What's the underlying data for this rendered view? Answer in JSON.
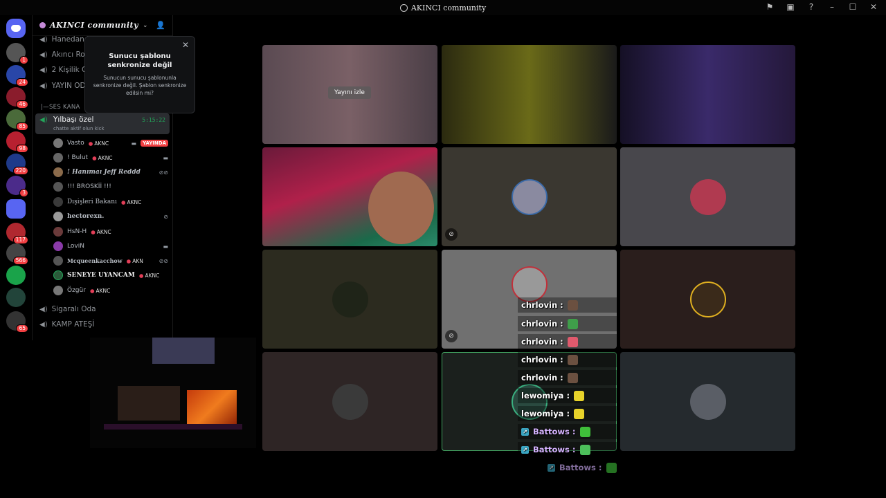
{
  "window": {
    "title": "AKINCI community"
  },
  "titlebar_icons": [
    "flag-icon",
    "screen-icon",
    "help-icon",
    "minimize-icon",
    "maximize-icon",
    "close-icon"
  ],
  "guild_badges": [
    "1",
    "24",
    "46",
    "85",
    "98",
    "220",
    "3",
    "117",
    "566",
    "65"
  ],
  "server": {
    "name": "AKINCI community"
  },
  "channels": {
    "top": [
      "Hanedan M",
      "Akıncı Ro",
      "2 Kişilik O",
      "YAYIN OD"
    ],
    "category": "|—SES KANA",
    "active": {
      "name": "Yılbaşı özel",
      "status": "chatte aktif olun kick",
      "timer": "5:15:22"
    },
    "bottom": [
      "Sigaralı Oda",
      "KAMP ATEŞİ"
    ]
  },
  "voice_users": [
    {
      "name": "Vasto",
      "tag": "AKNC",
      "live": "YAYINDA"
    },
    {
      "name": "! Bulut",
      "tag": "AKNC"
    },
    {
      "name": "! Hanımaı Jeff Reddd"
    },
    {
      "name": "!!! BROSKİİ !!!"
    },
    {
      "name": "Dışişleri Bakanı",
      "tag": "AKNC"
    },
    {
      "name": "hectorexn."
    },
    {
      "name": "HsN-H",
      "tag": "AKNC"
    },
    {
      "name": "LoviN"
    },
    {
      "name": "Mcqueenkacchow",
      "tag": "AKN"
    },
    {
      "name": "SENEYE UYANCAM",
      "tag": "AKNC"
    },
    {
      "name": "Özgür",
      "tag": "AKNC"
    }
  ],
  "popup": {
    "title": "Sunucu şablonu senkronize değil",
    "body": "Sunucun sunucu şablonunla senkronize değil. Şablon senkronize edilsin mi?"
  },
  "stream_tile": {
    "watch_label": "Yayını izle"
  },
  "chat_overlay": [
    {
      "user": "chrlovin :",
      "emote": "#6b5040"
    },
    {
      "user": "chrlovin :",
      "emote": "#3f9e4a"
    },
    {
      "user": "chrlovin :",
      "emote": "#e05a6d"
    },
    {
      "user": "chrlovin :",
      "emote": "#6b5040"
    },
    {
      "user": "chrlovin :",
      "emote": "#6b5040"
    },
    {
      "user": "lewomiya :",
      "emote": "#e8d32a"
    },
    {
      "user": "lewomiya :",
      "emote": "#e8d32a"
    },
    {
      "user": "Battows :",
      "emote": "#3fbf3a"
    },
    {
      "user": "Battows :",
      "emote": "#4cbf5a"
    },
    {
      "user": "Battows :",
      "emote": "#3fbf3a"
    }
  ]
}
